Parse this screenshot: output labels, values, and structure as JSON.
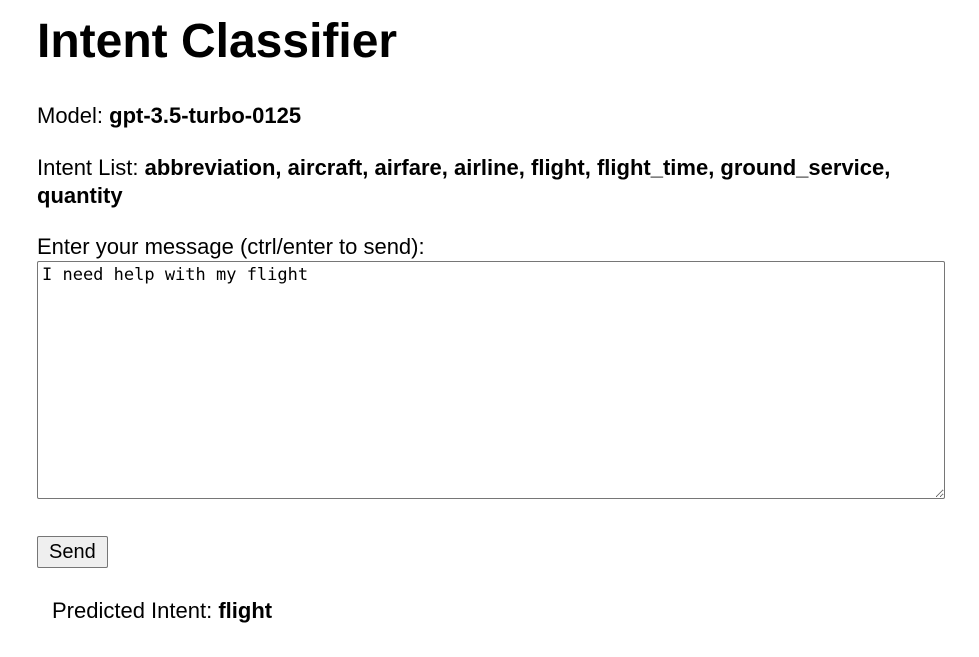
{
  "page": {
    "title": "Intent Classifier"
  },
  "model": {
    "label": "Model: ",
    "value": "gpt-3.5-turbo-0125"
  },
  "intents": {
    "label": "Intent List: ",
    "value": "abbreviation, aircraft, airfare, airline, flight, flight_time, ground_service, quantity"
  },
  "message": {
    "label": "Enter your message (ctrl/enter to send):",
    "value": "I need help with my flight"
  },
  "actions": {
    "send_label": "Send"
  },
  "result": {
    "label": "Predicted Intent: ",
    "value": "flight"
  }
}
